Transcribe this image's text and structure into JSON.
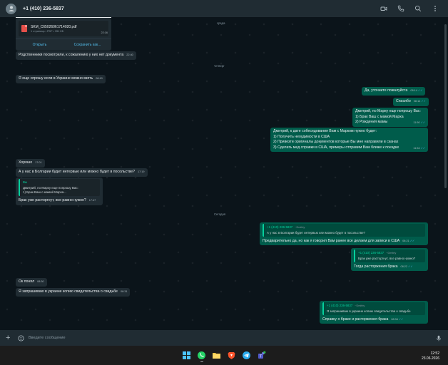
{
  "header": {
    "contact": "+1 (410) 236-5837",
    "icons": [
      "video-camera-icon",
      "phone-icon",
      "search-icon",
      "more-vertical-icon"
    ]
  },
  "document": {
    "filename": "SKM_C65026061714020.pdf",
    "meta": "1 страница • PDF • 351 КБ",
    "time": "22:16",
    "open_label": "Открыть",
    "save_label": "Сохранить как..."
  },
  "days": {
    "wednesday": "среда",
    "thursday": "четверг",
    "today": "Сегодня"
  },
  "messages": {
    "m1": {
      "text": "Родственники посмотрели, к сожалению у них нет документа",
      "time": "22:40"
    },
    "m2": {
      "text": "Я еще спрошу если в Украине можно взять",
      "time": "08:10"
    },
    "m3": {
      "text": "Да, уточните пожалуйста",
      "time": "08:14"
    },
    "m4": {
      "text": "Спасибо",
      "time": "08:14"
    },
    "m5": {
      "lines": [
        "Дмитрий, по Марку еще попрошу Вас:",
        "1) Брак Ваш с мамой Марка",
        "2) Рождения мамы"
      ],
      "time": "11:50"
    },
    "m6": {
      "lines": [
        "Дмитрий, к дате собеседования Вам с Марком нужно будет:",
        "1) Получить неоудимости в США",
        "2) Привезти оригиналы документов которые Вы мне направили в сканах",
        "3) Сделать мед справки в США, примеры отправим Вам ближе к поездке"
      ],
      "time": "11:54"
    },
    "m7": {
      "text": "Хорошо",
      "time": "17:01"
    },
    "m8": {
      "text": "А у нас в Болгарии будет интервью или можно будет в посольстве?",
      "time": "17:19"
    },
    "m9": {
      "quote_name": "Вы",
      "quote_lines": [
        "Дмитрий, по Марку еще попрошу Вас:",
        "1) Брак Ваш с мамой Марка..."
      ],
      "text": "Брак уже расторгнут, все равно нужно?",
      "time": "17:47"
    },
    "m10": {
      "quote_name": "+1 (410) 236-5837",
      "quote_tag": "~Dmitriy",
      "quote_text": "А у нас в Болгарии будет интервью или можно будет в посольстве?",
      "text": "Предварительно да, но как я говорил Вам ранее все делаем для записи в США",
      "time": "08:21"
    },
    "m11": {
      "quote_name": "+1 (410) 236-5837",
      "quote_tag": "~Dmitriy",
      "quote_text": "Брак уже расторгнут, все равно нужно?",
      "text": "Тогда расторжения брака",
      "time": "08:22"
    },
    "m12": {
      "text": "Ок понял",
      "time": "08:30"
    },
    "m13": {
      "text": "Я запрашиваю в украине копию свидетельства о свадьбе",
      "time": "08:31"
    },
    "m14": {
      "quote_name": "+1 (410) 236-5837",
      "quote_tag": "~Dmitriy",
      "quote_text": "Я запрашиваю в украине копию свидетельства о свадьбе",
      "text": "Справку о браке и расторжения брака",
      "time": "08:34"
    }
  },
  "composer": {
    "placeholder": "Введите сообщение"
  },
  "taskbar": {
    "apps": [
      "windows-start-icon",
      "whatsapp-icon",
      "file-explorer-icon",
      "brave-browser-icon",
      "telegram-icon",
      "teams-icon"
    ],
    "time": "12:52",
    "date": "23.06.2026"
  },
  "colors": {
    "incoming_bubble": "#202c33",
    "outgoing_bubble": "#005c4b",
    "background": "#0b141a",
    "accent": "#06cf9c",
    "read_tick": "#53bdeb"
  }
}
